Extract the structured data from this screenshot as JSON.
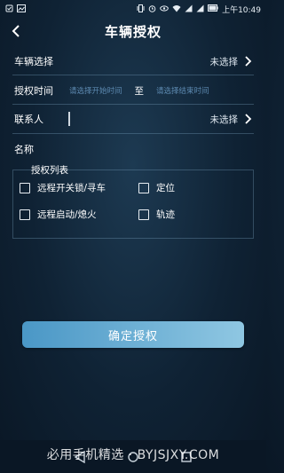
{
  "status_bar": {
    "time": "上午10:49",
    "left_icons": [
      "notification-icon",
      "image-icon"
    ],
    "right_icons": [
      "vibrate-icon",
      "alarm-icon",
      "eye-icon",
      "wifi-icon",
      "signal-icon",
      "signal-icon",
      "battery-icon"
    ]
  },
  "header": {
    "title": "车辆授权"
  },
  "form": {
    "vehicle": {
      "label": "车辆选择",
      "value": "未选择"
    },
    "auth_time": {
      "label": "授权时间",
      "start_placeholder": "请选择开始时间",
      "to": "至",
      "end_placeholder": "请选择结束时间"
    },
    "contact": {
      "label": "联系人",
      "value": "未选择"
    },
    "name": {
      "label": "名称"
    }
  },
  "auth_list": {
    "legend": "授权列表",
    "items": [
      {
        "label": "远程开关锁/寻车",
        "checked": false
      },
      {
        "label": "定位",
        "checked": false
      },
      {
        "label": "远程启动/熄火",
        "checked": false
      },
      {
        "label": "轨迹",
        "checked": false
      }
    ]
  },
  "confirm_button": {
    "label": "确定授权"
  },
  "watermark": {
    "text": "必用手机精选 · BYJSJXY.COM"
  },
  "colors": {
    "background": "#0f2234",
    "button_gradient_start": "#4a97c6",
    "button_gradient_end": "#8fc7e2",
    "placeholder": "#5d8ab1"
  }
}
